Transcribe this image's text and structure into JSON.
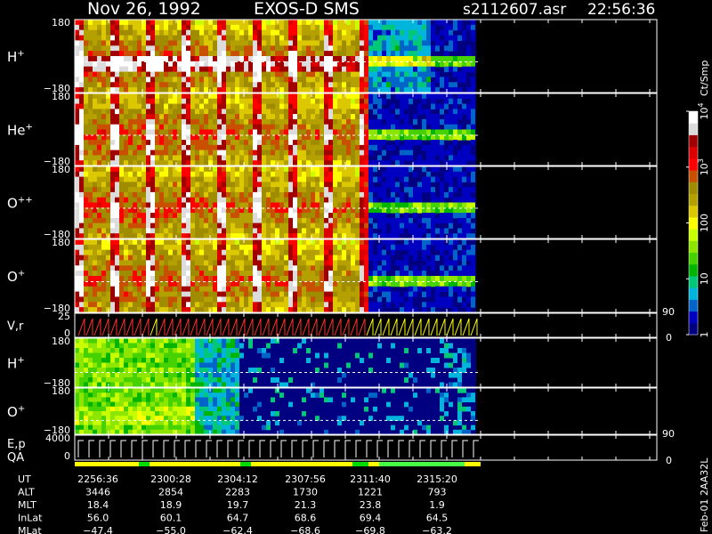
{
  "header": {
    "date": "Nov 26, 1992",
    "instrument": "EXOS-D SMS",
    "file": "s2112607.asr",
    "time": "22:56:36"
  },
  "footer_label": "Feb-01 2AA32L",
  "colorbar": {
    "label": "Ct/Smp",
    "ticks": [
      {
        "text": "1",
        "value": 1
      },
      {
        "text": "10",
        "value": 10
      },
      {
        "text": "100",
        "value": 100
      },
      {
        "text": "10",
        "sup": "3",
        "value": 1000
      },
      {
        "text": "10",
        "sup": "4",
        "value": 10000
      }
    ],
    "colors": [
      "#000080",
      "#0000c0",
      "#0064c8",
      "#00b4dc",
      "#00c878",
      "#00b400",
      "#46d200",
      "#8ce600",
      "#c8ff00",
      "#ffff00",
      "#dcc800",
      "#b4a000",
      "#a08c00",
      "#c85000",
      "#ff0000",
      "#dc0000",
      "#a00000",
      "#dcdcdc",
      "#ffffff"
    ]
  },
  "panels": [
    {
      "id": "h-plus-1",
      "label": "H",
      "sup": "+",
      "ymax": "180",
      "ymin": "−180"
    },
    {
      "id": "he-plus",
      "label": "He",
      "sup": "+",
      "ymax": "180",
      "ymin": "−180"
    },
    {
      "id": "o-plusplus",
      "label": "O",
      "sup": "++",
      "ymax": "180",
      "ymin": "−180"
    },
    {
      "id": "o-plus-1",
      "label": "O",
      "sup": "+",
      "ymax": "180",
      "ymin": "−180"
    },
    {
      "id": "v-r",
      "label": "V,r",
      "sup": "",
      "ymax": "25",
      "ymin": "0",
      "right_top": "90",
      "right_bottom": "0"
    },
    {
      "id": "h-plus-2",
      "label": "H",
      "sup": "+",
      "ymax": "180",
      "ymin": "−180"
    },
    {
      "id": "o-plus-2",
      "label": "O",
      "sup": "+",
      "ymax": "180",
      "ymin": "−180"
    },
    {
      "id": "e-p",
      "label": "E,p",
      "sup": "",
      "ymax": "4000",
      "ymin": "0",
      "right_top": "90",
      "right_bottom": "0",
      "extra_label": "QA"
    }
  ],
  "ephemeris": {
    "rows": [
      {
        "label": "UT",
        "values": [
          "2256:36",
          "2300:28",
          "2304:12",
          "2307:56",
          "2311:40",
          "2315:20"
        ]
      },
      {
        "label": "ALT",
        "values": [
          "3446",
          "2854",
          "2283",
          "1730",
          "1221",
          "793"
        ]
      },
      {
        "label": "MLT",
        "values": [
          "18.4",
          "18.9",
          "19.7",
          "21.3",
          "23.8",
          "1.9"
        ]
      },
      {
        "label": "InLat",
        "values": [
          "56.0",
          "60.1",
          "64.7",
          "68.6",
          "69.4",
          "64.5"
        ]
      },
      {
        "label": "MLat",
        "values": [
          "−47.4",
          "−55.0",
          "−62.4",
          "−68.6",
          "−69.8",
          "−63.2"
        ]
      }
    ]
  },
  "chart_data": {
    "type": "heatmap",
    "x": [
      "2256:36",
      "2300:28",
      "2304:12",
      "2307:56",
      "2311:40",
      "2315:20"
    ],
    "series": [
      {
        "name": "H+",
        "ylim": [
          -180,
          180
        ]
      },
      {
        "name": "He+",
        "ylim": [
          -180,
          180
        ]
      },
      {
        "name": "O++",
        "ylim": [
          -180,
          180
        ]
      },
      {
        "name": "O+",
        "ylim": [
          -180,
          180
        ]
      },
      {
        "name": "V,r",
        "ylim": [
          0,
          25
        ]
      },
      {
        "name": "H+",
        "ylim": [
          -180,
          180
        ]
      },
      {
        "name": "O+",
        "ylim": [
          -180,
          180
        ]
      },
      {
        "name": "E,p",
        "ylim": [
          0,
          4000
        ]
      }
    ],
    "colorbar": {
      "scale": "log",
      "range": [
        1,
        10000
      ],
      "unit": "Ct/Smp"
    }
  }
}
